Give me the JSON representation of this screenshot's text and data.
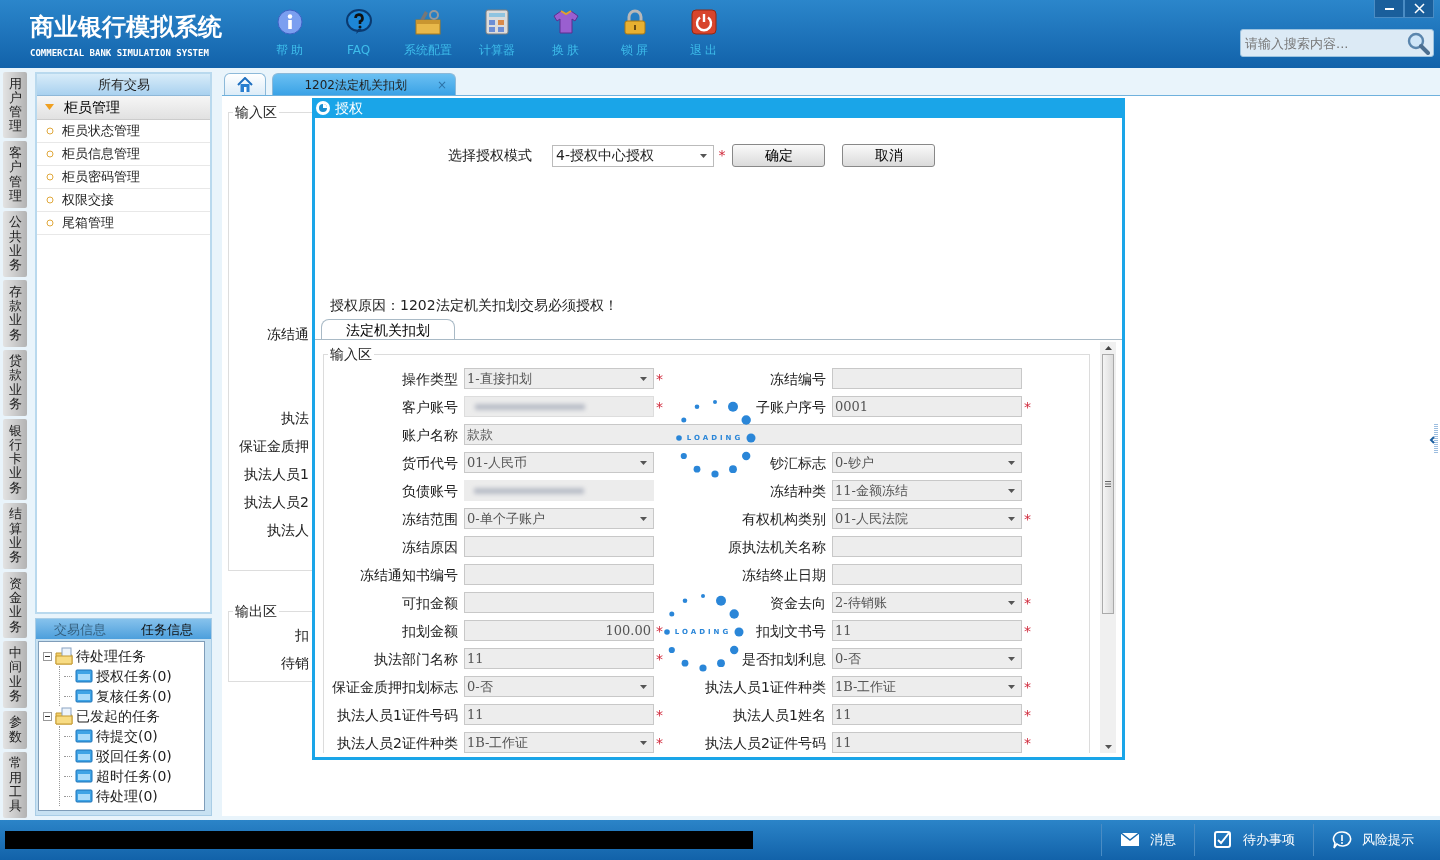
{
  "window": {
    "title": "商业银行模拟系统",
    "subtitle": "COMMERCIAL BANK SIMULATION SYSTEM"
  },
  "toolbar": [
    {
      "kind": "help",
      "label": "帮 助"
    },
    {
      "kind": "faq",
      "label": "FAQ"
    },
    {
      "kind": "config",
      "label": "系统配置"
    },
    {
      "kind": "calculator",
      "label": "计算器"
    },
    {
      "kind": "skin",
      "label": "换 肤"
    },
    {
      "kind": "lock",
      "label": "锁 屏"
    },
    {
      "kind": "exit",
      "label": "退 出"
    }
  ],
  "search": {
    "placeholder": "请输入搜索内容..."
  },
  "side_tabs": [
    {
      "label": "用户管理"
    },
    {
      "label": "客户管理"
    },
    {
      "label": "公共业务"
    },
    {
      "label": "存款业务"
    },
    {
      "label": "贷款业务"
    },
    {
      "label": "银行卡业务"
    },
    {
      "label": "结算业务"
    },
    {
      "label": "资金业务"
    },
    {
      "label": "中间业务"
    },
    {
      "label": "参数"
    },
    {
      "label": "常用工具"
    }
  ],
  "menu": {
    "title": "所有交易",
    "groups": [
      {
        "label": "柜员管理",
        "expanded": true,
        "items": [
          {
            "label": "柜员状态管理"
          },
          {
            "label": "柜员信息管理"
          },
          {
            "label": "柜员密码管理"
          },
          {
            "label": "权限交接"
          },
          {
            "label": "尾箱管理"
          }
        ]
      }
    ]
  },
  "info_tabs": [
    {
      "label": "交易信息",
      "selected": false
    },
    {
      "label": "任务信息",
      "selected": true
    }
  ],
  "task_tree": [
    {
      "label": "待处理任务",
      "expanded": true,
      "children": [
        {
          "label": "授权任务(0)"
        },
        {
          "label": "复核任务(0)"
        }
      ]
    },
    {
      "label": "已发起的任务",
      "expanded": true,
      "children": [
        {
          "label": "待提交(0)"
        },
        {
          "label": "驳回任务(0)"
        },
        {
          "label": "超时任务(0)"
        },
        {
          "label": "待处理(0)"
        }
      ]
    }
  ],
  "tabs": [
    {
      "kind": "home",
      "selected": false
    },
    {
      "kind": "page",
      "label": "1202法定机关扣划",
      "close": "×",
      "selected": true
    }
  ],
  "background_form": {
    "input_title": "输入区",
    "input_labels": [
      "冻结通",
      "执法",
      "保证金质押",
      "执法人员1",
      "执法人员2",
      "执法人"
    ],
    "output_title": "输出区",
    "output_labels": [
      "扣",
      "待销"
    ]
  },
  "dialog": {
    "title": "授权",
    "mode_label": "选择授权模式",
    "mode_value": "4-授权中心授权",
    "mark": "*",
    "buttons": [
      {
        "label": "确定"
      },
      {
        "label": "取消"
      }
    ],
    "reason": "授权原因：1202法定机关扣划交易必须授权！",
    "tab": {
      "label": "法定机关扣划",
      "selected": true
    },
    "form": {
      "title": "输入区",
      "fields": [
        {
          "label": "操作类型",
          "kind": "select",
          "value": "1-直接扣划",
          "mark": "*"
        },
        {
          "label": "冻结编号",
          "kind": "input"
        },
        {
          "label": "客户账号",
          "kind": "redacted",
          "mark": "*"
        },
        {
          "label": "子账户序号",
          "kind": "input",
          "value": "0001",
          "mark": "*"
        },
        {
          "label": "账户名称",
          "kind": "wide",
          "value": "款款"
        },
        {
          "label": "货币代号",
          "kind": "select",
          "value": "01-人民币"
        },
        {
          "label": "钞汇标志",
          "kind": "select",
          "value": "0-钞户"
        },
        {
          "label": "负债账号",
          "kind": "redacted"
        },
        {
          "label": "冻结种类",
          "kind": "select",
          "value": "11-金额冻结"
        },
        {
          "label": "冻结范围",
          "kind": "select",
          "value": "0-单个子账户"
        },
        {
          "label": "有权机构类别",
          "kind": "select",
          "value": "01-人民法院",
          "mark": "*"
        },
        {
          "label": "冻结原因",
          "kind": "input"
        },
        {
          "label": "原执法机关名称",
          "kind": "input"
        },
        {
          "label": "冻结通知书编号",
          "kind": "input"
        },
        {
          "label": "冻结终止日期",
          "kind": "input"
        },
        {
          "label": "可扣金额",
          "kind": "input"
        },
        {
          "label": "资金去向",
          "kind": "select",
          "value": "2-待销账",
          "mark": "*"
        },
        {
          "label": "扣划金额",
          "kind": "amount",
          "value": "100.00",
          "mark": "*"
        },
        {
          "label": "扣划文书号",
          "kind": "input",
          "value": "11",
          "mark": "*"
        },
        {
          "label": "执法部门名称",
          "kind": "input",
          "value": "11",
          "mark": "*"
        },
        {
          "label": "是否扣划利息",
          "kind": "select",
          "value": "0-否"
        },
        {
          "label": "保证金质押扣划标志",
          "kind": "select",
          "value": "0-否"
        },
        {
          "label": "执法人员1证件种类",
          "kind": "select",
          "value": "1B-工作证",
          "mark": "*"
        },
        {
          "label": "执法人员1证件号码",
          "kind": "input",
          "value": "11",
          "mark": "*"
        },
        {
          "label": "执法人员1姓名",
          "kind": "input",
          "value": "11",
          "mark": "*"
        },
        {
          "label": "执法人员2证件种类",
          "kind": "select",
          "value": "1B-工作证",
          "mark": "*"
        },
        {
          "label": "执法人员2证件号码",
          "kind": "input",
          "value": "11",
          "mark": "*"
        }
      ]
    },
    "loading": [
      {
        "text": "LOADING"
      },
      {
        "text": "LOADING"
      }
    ]
  },
  "footer": {
    "buttons": [
      {
        "kind": "message",
        "label": "消息"
      },
      {
        "kind": "todo",
        "label": "待办事项"
      },
      {
        "kind": "risk",
        "label": "风险提示"
      }
    ]
  }
}
